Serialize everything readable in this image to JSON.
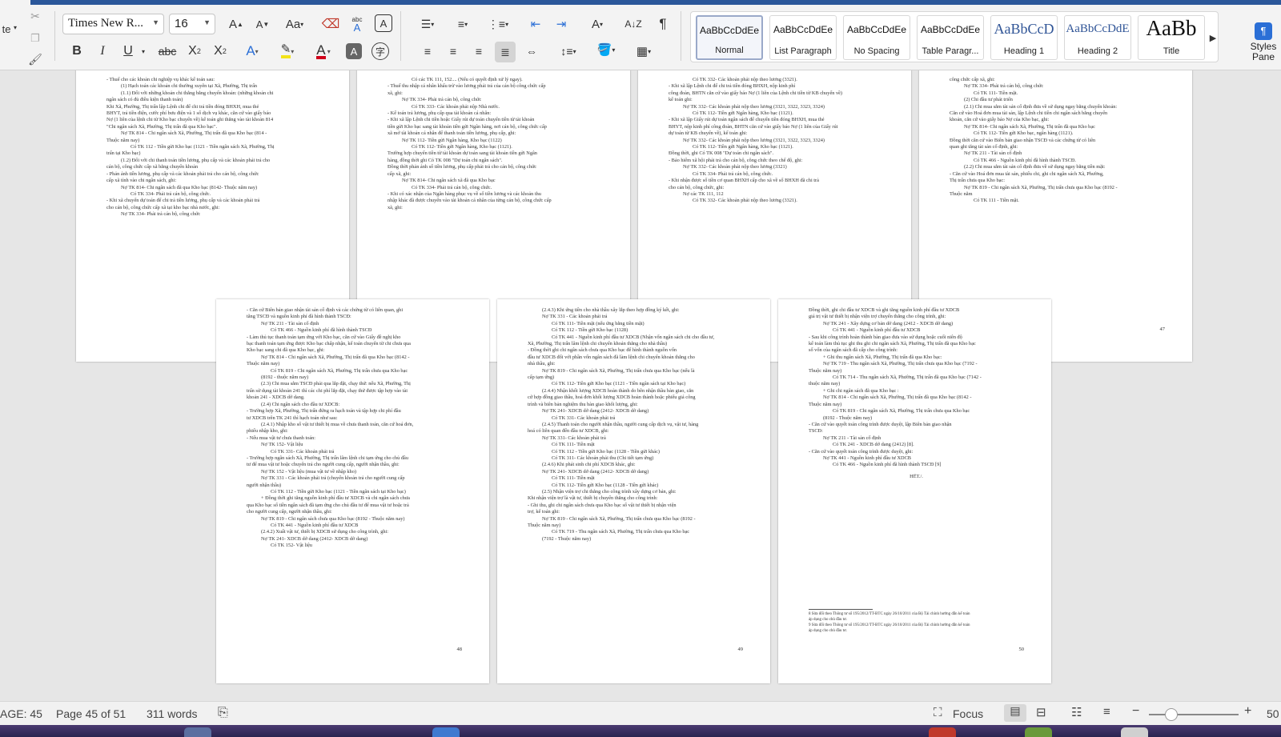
{
  "ribbon": {
    "left_fragment": "te",
    "font_name": "Times New R...",
    "font_size": "16",
    "styles": [
      {
        "sample": "AaBbCcDdEe",
        "name": "Normal",
        "active": true
      },
      {
        "sample": "AaBbCcDdEe",
        "name": "List Paragraph",
        "active": false
      },
      {
        "sample": "AaBbCcDdEe",
        "name": "No Spacing",
        "active": false
      },
      {
        "sample": "AaBbCcDdEe",
        "name": "Table Paragr...",
        "active": false
      },
      {
        "sample": "AaBbCcD",
        "name": "Heading 1",
        "active": false
      },
      {
        "sample": "AaBbCcDdE",
        "name": "Heading 2",
        "active": false
      },
      {
        "sample": "AaBb",
        "name": "Title",
        "active": false
      }
    ],
    "styles_pane_label": "Styles Pane",
    "icons": [
      "cut-icon",
      "copy-icon",
      "format-painter-icon",
      "grow-font-icon",
      "shrink-font-icon",
      "change-case-icon",
      "clear-formatting-icon",
      "phonetic-guide-icon",
      "character-border-icon",
      "bold-icon",
      "italic-icon",
      "underline-icon",
      "strikethrough-icon",
      "subscript-icon",
      "superscript-icon",
      "text-effects-icon",
      "highlight-icon",
      "font-color-icon",
      "character-shading-icon",
      "enclose-characters-icon",
      "bullets-icon",
      "numbering-icon",
      "multilevel-list-icon",
      "decrease-indent-icon",
      "increase-indent-icon",
      "asian-layout-icon",
      "sort-icon",
      "show-formatting-icon",
      "align-left-icon",
      "center-icon",
      "align-right-icon",
      "justify-icon",
      "distributed-icon",
      "line-spacing-icon",
      "shading-icon",
      "borders-icon"
    ]
  },
  "pages": [
    {
      "number": "44",
      "lines": [
        "- Thuế cho các khoản chi nghiệp vụ khác kế toán sau:",
        "(1) Hạch toán các khoản chi thường xuyên tại Xã, Phường, Thị trấn",
        "(1.1) Đối với những khoản chi thẳng bằng chuyển khoản: (những khoản chi",
        "ngân sách có đủ điều kiện thanh toán)",
        "Khi Xã, Phường, Thị trấn lập Lệnh chi để chi trả tiền đóng BHXH, mua thẻ",
        "BHYT, trả tiền điện, cước phí bưu điện và 1 số dịch vụ khác, căn cứ vào giấy báo",
        "Nợ (1 liên của lệnh chi từ Kho bạc chuyển về) kế toán ghi thẳng vào tài khoản 814",
        "\"Chi ngân sách Xã, Phường, Thị trấn đã qua Kho bạc\".",
        "Nợ TK 814 - Chi ngân sách Xã, Phường, Thị trấn đã qua Kho bạc (814 -",
        "Thuộc năm nay)",
        "Có TK 112 - Tiền gửi Kho bạc (1121 - Tiền ngân sách Xã, Phường, Thị",
        "trấn tại Kho bạc)",
        "(1.2) Đối với chi thanh toán tiền lương, phụ cấp và các khoản phải trả cho",
        "cán bộ, công chức cấp xã bằng chuyển khoản",
        "- Phản ánh tiền lương, phụ cấp và các khoản phải trả cho cán bộ, công chức",
        "cấp xã tính vào chi ngân sách, ghi:",
        "Nợ TK 814- Chi ngân sách đã qua Kho bạc (8142- Thuộc năm nay)",
        "Có TK 334- Phải trả cán bộ, công chức.",
        "- Khi xã chuyển dự toán để chi trả tiền lương, phụ cấp và các khoản phải trả",
        "cho cán bộ, công chức cấp xã tại kho bạc nhà nước, ghi:",
        "Nợ TK 334- Phải trả cán bộ, công chức"
      ]
    },
    {
      "number": "45",
      "lines": [
        "Có các TK 111, 152.... (Nếu có quyết định xử lý ngay).",
        "- Thuế thu nhập cá nhân khấu trừ vào lương phải trả của cán bộ công chức cấp",
        "xã, ghi:",
        "Nợ TK 334- Phải trả cán bộ, công chức",
        "Có TK 333- Các khoản phải nộp Nhà nước.",
        "- Kế toán trả lương, phụ cấp qua tài khoản cá nhân:",
        "- Khi xã lập Lệnh chi tiền hoặc Giấy rút dự toán chuyển tiền từ tài khoản",
        "tiền gửi Kho bạc sang tài khoản tiền gửi Ngân hàng, nơi cán bộ, công chức cấp",
        "xã mở tài khoản cá nhân để thanh toán tiền lương, phụ cấp, ghi:",
        "Nợ TK 112- Tiền gửi Ngân hàng, Kho bạc (1122)",
        "Có TK 112- Tiền gửi Ngân hàng, Kho bạc (1121).",
        "Trường hợp chuyển tiền từ tài khoản dự toán sang tài khoản tiền gửi Ngân",
        "hàng, đồng thời ghi Có TK 008 \"Dự toán chi ngân sách\".",
        "Đồng thời phản ánh số tiền lương, phụ cấp phải trả cho cán bộ, công chức",
        "cấp xã, ghi:",
        "Nợ TK 814- Chi ngân sách xã đã qua Kho bạc",
        "Có TK 334- Phải trả cán bộ, công chức.",
        "- Khi có xác nhận của Ngân hàng phục vụ về số tiền lương và các khoản thu",
        "nhập khác đã được chuyển vào tài khoản cá nhân của từng cán bộ, công chức cấp",
        "xã, ghi:"
      ]
    },
    {
      "number": "46",
      "lines": [
        "Có TK 332- Các khoản phải nộp theo lương (3321).",
        "- Khi xã lập Lệnh chi để chi trả tiền đóng BHXH, nộp kinh phí",
        "công đoàn, BHTN căn cứ vào giấy báo Nợ (1 liên của Lệnh chi tiền từ KB chuyển về)",
        "kế toán ghi:",
        "Nợ TK 332- Các khoản phải nộp theo lương (3321, 3322, 3323, 3324)",
        "Có TK 112- Tiền gửi Ngân hàng, Kho bạc (1121).",
        "- Khi xã lập Giấy rút dự toán ngân sách để chuyển tiền đóng BHXH, mua thẻ",
        "BHYT, nộp kinh phí công đoàn, BHTN căn cứ vào giấy báo Nợ (1 liên của Giấy rút",
        "dự toán từ KB chuyển về), kế toán ghi:",
        "Nợ TK 332- Các khoản phải nộp theo lương (3321, 3322, 3323, 3324)",
        "Có TK 112- Tiền gửi Ngân hàng, Kho bạc (1121).",
        "Đồng thời, ghi Có TK 008 \"Dự toán chi ngân sách\".",
        "- Bảo hiểm xã hội phải trả cho cán bộ, công chức theo chế độ, ghi:",
        "Nợ TK 332- Các khoản phải nộp theo lương (3321)",
        "Có TK 334- Phải trả cán bộ, công chức.",
        "- Khi nhận được số tiền cơ quan BHXH cấp cho xã về số BHXH đã chi trả",
        "cho cán bộ, công chức, ghi:",
        "Nợ các TK 111, 112",
        "Có TK 332- Các khoản phải nộp theo lương (3321)."
      ]
    },
    {
      "number": "47",
      "lines": [
        "công chức cấp xã, ghi:",
        "Nợ TK 334- Phải trả cán bộ, công chức",
        "Có TK 111- Tiền mặt.",
        "(2) Chi đầu tư phát triển",
        "(2.1) Chi mua sắm tài sản cố định đưa về sử dụng ngay bằng chuyển khoản:",
        "Căn cứ vào Hoá đơn mua tài sản, lập Lệnh chi tiền chi ngân sách bằng chuyển",
        "khoản, căn cứ vào giấy báo Nợ của Kho bạc, ghi:",
        "Nợ TK 814- Chi ngân sách Xã, Phường, Thị trấn đã qua Kho bạc",
        "Có TK 112- Tiền gửi Kho bạc, ngân hàng (1121).",
        "Đồng thời căn cứ vào Biên bản giao nhận TSCĐ và các chứng từ có liên",
        "quan ghi tăng tài sản cố định, ghi:",
        "Nợ TK 211 - Tài sản cố định",
        "Có TK 466 - Nguồn kinh phí đã hình thành TSCĐ.",
        "(2.2) Chi mua sắm tài sản cố định đưa về sử dụng ngay bằng tiền mặt:",
        "- Căn cứ vào Hoá đơn mua tài sản, phiếu chi, ghi chi ngân sách Xã, Phường,",
        "Thị trấn chưa qua Kho bạc:",
        "Nợ TK 819 - Chi ngân sách Xã, Phường, Thị trấn chưa qua Kho bạc (8192 -",
        "Thuộc năm",
        "Có TK 111 - Tiền mặt."
      ]
    },
    {
      "number": "48",
      "lines": [
        "- Căn cứ Biên bản giao nhận tài sản cố định và các chứng từ có liên quan, ghi",
        "tăng TSCĐ và nguồn kinh phí đã hình thành TSCĐ:",
        "Nợ TK 211 - Tài sản cố định",
        "Có TK 466 - Nguồn kinh phí đã hình thành TSCĐ",
        "- Làm thủ tục thanh toán tạm ứng với Kho bạc, căn cứ vào Giấy đề nghị kho",
        "bạc thanh toán tạm ứng được Kho bạc chấp nhận, kế toán chuyển từ chi chưa qua",
        "Kho bạc sang chi đã qua Kho bạc, ghi:",
        "Nợ TK 814 - Chi ngân sách Xã, Phường, Thị trấn đã qua Kho bạc (8142 -",
        "Thuộc năm nay)",
        "Có TK 819 - Chi ngân sách Xã, Phường, Thị trấn chưa qua Kho bạc",
        "(8192 - thuộc năm nay)",
        "(2.3) Chi mua sắm TSCĐ phải qua lắp đặt, chạy thử: nếu Xã, Phường, Thị",
        "trấn sử dụng tài khoản 241 thì các chi phí lắp đặt, chạy thử được tập hợp vào tài",
        "khoản 241 - XDCB dở dang.",
        "(2.4) Chi ngân sách cho đầu tư XDCB:",
        "- Trường hợp Xã, Phường, Thị trấn đứng ra hạch toán và tập hợp chi phí đầu",
        "tư XDCB trên TK 241 thì hạch toán như sau:",
        "(2.4.1) Nhập kho số vật tư thiết bị mua về chưa thanh toán, căn cứ hoá đơn,",
        "phiếu nhập kho, ghi:",
        "- Nếu mua vật tư chưa thanh toán:",
        "Nợ TK 152- Vật liệu",
        "Có TK 331- Các khoản phải trả",
        "- Trường hợp ngân sách Xã, Phường, Thị trấn lâm lệnh chi tạm ứng cho chủ đầu",
        "tư để mua vật tư hoặc chuyển trả cho người cung cấp, người nhận thầu, ghi:",
        "Nợ TK 152 - Vật liệu (mua vật tư về nhập kho)",
        "Nợ TK 331 - Các khoản phải trả (chuyển khoản trả cho người cung cấp",
        "người nhận thầu)",
        "Có TK 112 - Tiền gửi Kho bạc (1121 - Tiền ngân sách tại Kho bạc)",
        "+ Đồng thời ghi tăng nguồn kinh phí đầu tư XDCB và chi ngân sách chưa",
        "qua Kho bạc số tiền ngân sách đã tạm ứng cho chủ đầu tư để mua vật tư hoặc trả",
        "cho người cung cấp, người nhận thầu, ghi:",
        "Nợ TK 819 - Chi ngân sách chưa qua Kho bạc (8192 - Thuộc năm nay)",
        "Có TK 441 - Nguồn kinh phí đầu tư XDCB",
        "(2.4.2) Xuất vật tư, thiết bị XDCB sử dụng cho công trình, ghi:",
        "Nợ TK 241- XDCB dở dang (2412- XDCB dở dang)",
        "Có TK 152- Vật liệu"
      ]
    },
    {
      "number": "49",
      "lines": [
        "(2.4.3) Khi ứng tiền cho nhà thầu xây lắp theo hợp đồng ký kết, ghi:",
        "Nợ TK 331 - Các khoản phải trả",
        "Có TK 111- Tiền mặt (nếu ứng bằng tiền mặt)",
        "Có TK 112 - Tiền gửi Kho bạc (1128)",
        "Có TK 441 - Nguồn kinh phí đầu tư XDCB (Nhận vốn ngân sách chi cho đầu tư,",
        "Xã, Phường, Thị trấn lâm lệnh chi chuyển khoản thẳng cho nhà thầu)",
        "- Đồng thời ghi chi ngân sách chưa qua Kho bạc để hình thành nguồn vốn",
        "đầu tư XDCB đối với phần vốn ngân sách đã làm lệnh chi chuyển khoản thẳng cho",
        "nhà thầu, ghi:",
        "Nợ TK 819 - Chi ngân sách Xã, Phường, Thị trấn chưa qua Kho bạc (nếu là",
        "cấp tạm ứng)",
        "Có TK 112- Tiền gửi Kho bạc (1121 - Tiền ngân sách tại Kho bạc)",
        "(2.4.4) Nhận khối lượng XDCB hoàn thành do bên nhận thầu bàn giao, căn",
        "cứ hợp đồng giao thầu, hoá đơn khối lượng XDCB hoàn thành hoặc phiếu giá công",
        "trình và biên bản nghiệm thu bàn giao khối lượng, ghi:",
        "Nợ TK 241- XDCB dở dang (2412- XDCB dở dang)",
        "Có TK 331- Các khoản phải trả",
        "(2.4.5) Thanh toán cho người nhận thầu, người cung cấp dịch vụ, vật tư, hàng",
        "hoá có liên quan đến đầu tư XDCB, ghi:",
        "Nợ TK 331- Các khoản phải trả",
        "Có TK 111- Tiền mặt",
        "Có TK 112 - Tiền gửi Kho bạc (1128 - Tiền gửi khác)",
        "Có TK 311- Các khoản phải thu (Chi tiết tạm ứng)",
        "(2.4.6) Khi phát sinh chi phí XDCB khác, ghi:",
        "Nợ TK 241- XDCB dở dang (2412- XDCB dở dang)",
        "Có TK 111- Tiền mặt",
        "Có TK 112- Tiền gửi Kho bạc (1128 - Tiền gửi khác)",
        "(2.5) Nhận viện trợ chi thẳng cho công trình xây dựng cơ bản, ghi:",
        "Khi nhận viện trợ là vật tư, thiết bị chuyển thẳng cho công trình:",
        "- Ghi thu, ghi chi ngân sách chưa qua Kho bạc số vật tư thiết bị nhận viện",
        "trợ, kế toán ghi:",
        "Nợ TK 819 - Chi ngân sách Xã, Phường, Thị trấn chưa qua Kho bạc (8192 -",
        "Thuộc năm nay)",
        "Có TK 719 - Thu ngân sách Xã, Phường, Thị trấn chưa qua Kho bạc",
        "(7192 - Thuộc năm nay)"
      ]
    },
    {
      "number": "50",
      "lines": [
        "Đồng thời, ghi chi đầu tư XDCB và ghi tăng nguồn kinh phí đầu tư XDCB",
        "giá trị vật tư thiết bị nhận viện trợ chuyển thẳng cho công trình, ghi:",
        "Nợ TK 241 - Xây dựng cơ bản dở dang (2412 - XDCB dở dang)",
        "Có TK 441 - Nguồn kinh phí đầu tư XDCB",
        "- Sau khi công trình hoàn thành bàn giao đưa vào sử dụng hoặc cuối niên độ",
        "kế toán làm thủ tục ghi thu ghi chi ngân sách Xã, Phường, Thị trấn đã qua Kho bạc",
        "số vốn của ngân sách đã cấp cho công trình:",
        "+ Ghi thu ngân sách Xã, Phường, Thị trấn đã qua Kho bạc:",
        "Nợ TK 719 - Thu ngân sách Xã, Phường, Thị trấn chưa qua Kho bạc (7192 -",
        "Thuộc năm nay)",
        "Có TK 714 - Thu ngân sách Xã, Phường, Thị trấn đã qua Kho bạc (7142 -",
        "thuộc năm nay)",
        "+ Ghi chi ngân sách đã qua Kho bạc :",
        "Nợ TK 814 - Chi ngân sách Xã, Phường, Thị trấn đã qua Kho bạc (8142 -",
        "Thuộc năm nay)",
        "Có TK 819 - Chi ngân sách Xã, Phường, Thị trấn chưa qua Kho bạc",
        "(8192 - Thuộc năm nay)",
        "- Căn cứ vào quyết toán công trình được duyệt, lập Biên bản giao nhận",
        "TSCĐ:",
        "Nợ TK 211 - Tài sản cố định",
        "Có TK 241 - XDCB dở dang (2412) [8].",
        "- Căn cứ vào quyết toán công trình được duyệt, ghi:",
        "Nợ TK 441 - Nguồn kinh phí đầu tư XDCB",
        "Có TK 466 - Nguồn kinh phí đã hình thành TSCĐ [9]",
        "",
        "HẾT./."
      ],
      "footnotes": [
        "8 Sửa đổi theo Thông tư số 195/2012/TT-BTC ngày 26/10/2011 của Bộ Tài chính hướng dẫn kế toán",
        "áp dụng cho chủ đầu tư.",
        "9 Sửa đổi theo Thông tư số 195/2012/TT-BTC ngày 26/10/2011 của Bộ Tài chính hướng dẫn kế toán",
        "áp dụng cho chủ đầu tư."
      ]
    }
  ],
  "status": {
    "page_fragment": "AGE: 45",
    "page_of": "Page 45 of 51",
    "words": "311 words",
    "focus": "Focus",
    "zoom_fragment": "50"
  }
}
